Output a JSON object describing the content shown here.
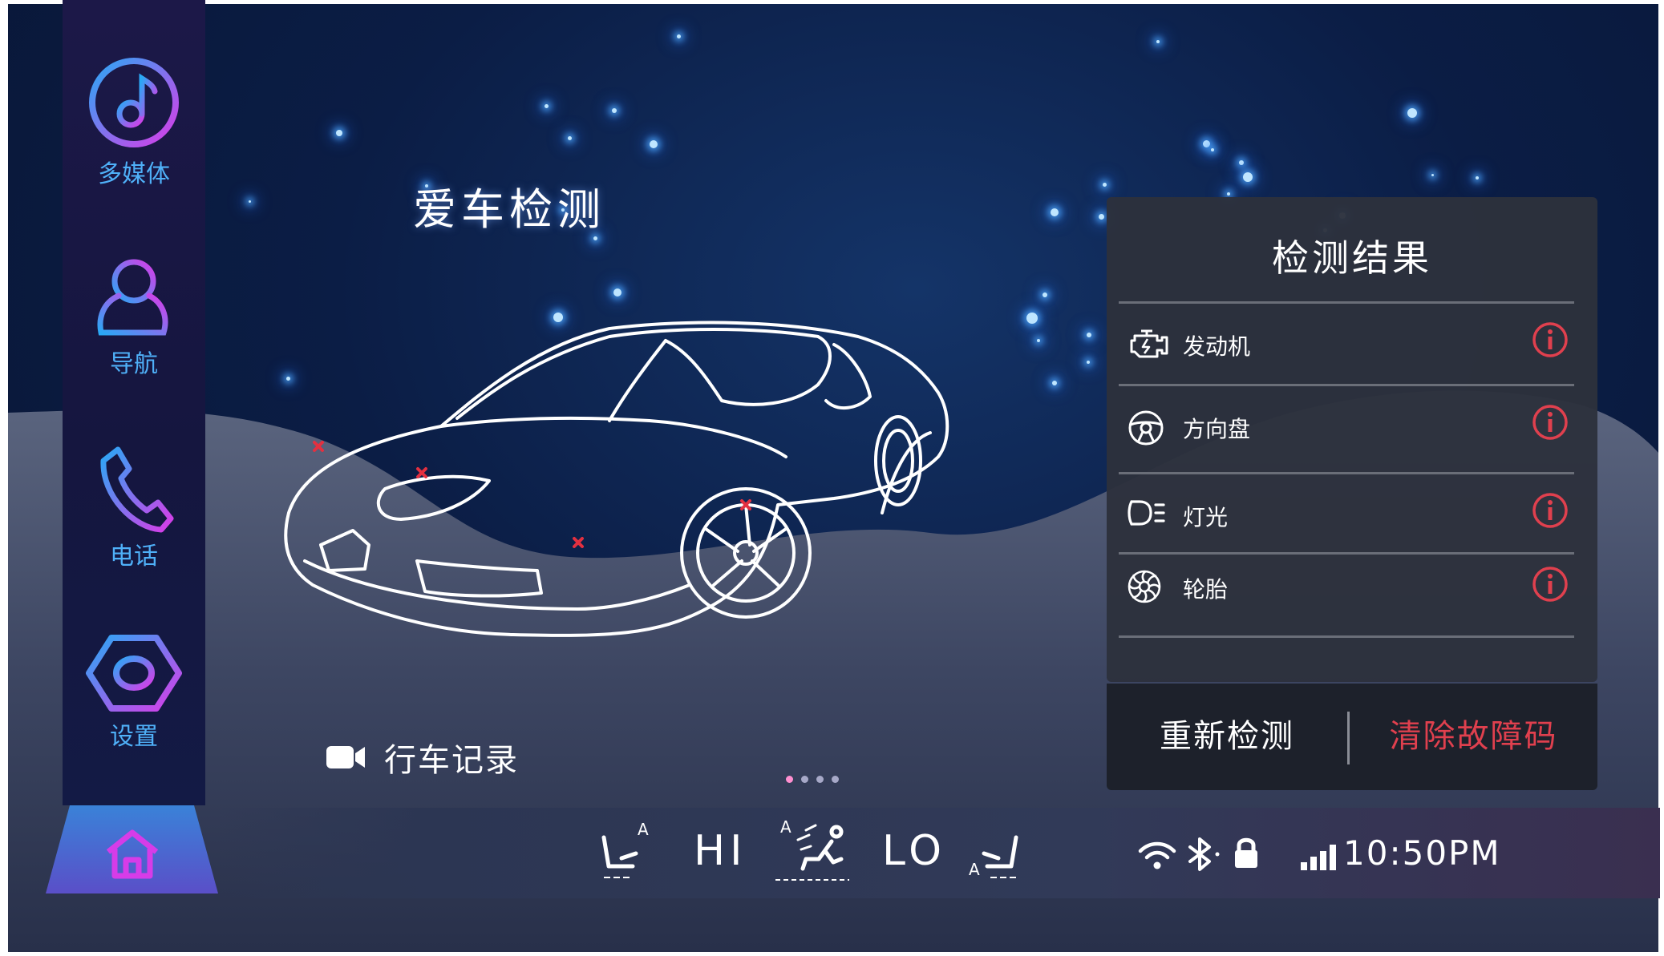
{
  "nav": {
    "items": [
      {
        "label": "多媒体",
        "icon": "music-note-icon"
      },
      {
        "label": "导航",
        "icon": "user-icon"
      },
      {
        "label": "电话",
        "icon": "phone-icon"
      },
      {
        "label": "设置",
        "icon": "hexagon-settings-icon"
      }
    ],
    "home_icon": "home-icon"
  },
  "page": {
    "title": "爱车检测",
    "dashcam_label": "行车记录",
    "page_count": 4,
    "active_page": 1
  },
  "results": {
    "title": "检测结果",
    "items": [
      {
        "label": "发动机",
        "icon": "engine-icon",
        "status_icon": "info-icon"
      },
      {
        "label": "方向盘",
        "icon": "steering-wheel-icon",
        "status_icon": "info-icon"
      },
      {
        "label": "灯光",
        "icon": "headlight-icon",
        "status_icon": "info-icon"
      },
      {
        "label": "轮胎",
        "icon": "tire-icon",
        "status_icon": "info-icon"
      }
    ],
    "redetect_label": "重新检测",
    "clear_label": "清除故障码"
  },
  "climate": {
    "seat_heat_left_mode": "A",
    "fan_high": "HI",
    "airflow_mode": "A",
    "fan_low": "LO",
    "seat_heat_right_mode": "A"
  },
  "status": {
    "time": "10:50PM",
    "icons": [
      "wifi-icon",
      "bluetooth-icon",
      "lock-icon",
      "signal-icon"
    ]
  },
  "colors": {
    "accent_blue": "#38a6f5",
    "accent_pink": "#d63ce8",
    "warning_red": "#e0404e"
  }
}
